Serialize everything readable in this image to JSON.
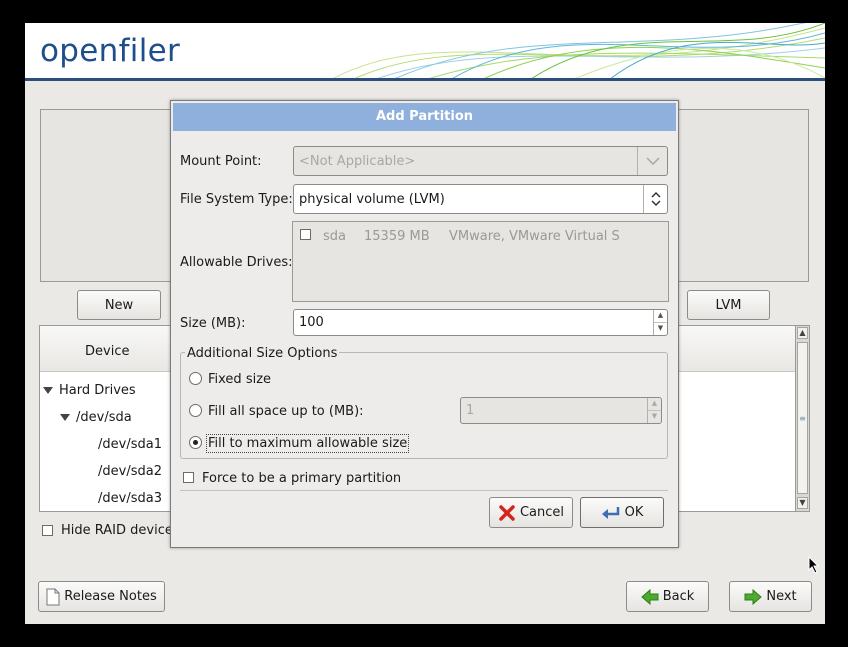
{
  "brand": {
    "logo_text": "openfiler",
    "accent": "#2d4e7b"
  },
  "buttons": {
    "new_label": "New",
    "lvm_label": "LVM",
    "release_notes_label": "Release Notes",
    "back_label": "Back",
    "next_label": "Next"
  },
  "tree": {
    "column_device": "Device",
    "rows": [
      "Hard Drives",
      "/dev/sda",
      "/dev/sda1",
      "/dev/sda2",
      "/dev/sda3"
    ]
  },
  "hide_raid_label": "Hide RAID device/",
  "dialog": {
    "title": "Add Partition",
    "mount_point_label": "Mount Point:",
    "mount_point_value": "<Not Applicable>",
    "fs_type_label": "File System Type:",
    "fs_type_value": "physical volume (LVM)",
    "allowable_drives_label": "Allowable Drives:",
    "drive": {
      "name": "sda",
      "size": "15359 MB",
      "model": "VMware, VMware Virtual S"
    },
    "size_label": "Size (MB):",
    "size_value": "100",
    "size_options_title": "Additional Size Options",
    "opt_fixed": "Fixed size",
    "opt_fill_up_to": "Fill all space up to (MB):",
    "fill_up_to_value": "1",
    "opt_fill_max": "Fill to maximum allowable size",
    "force_primary_label": "Force to be a primary partition",
    "cancel_label": "Cancel",
    "ok_label": "OK"
  }
}
